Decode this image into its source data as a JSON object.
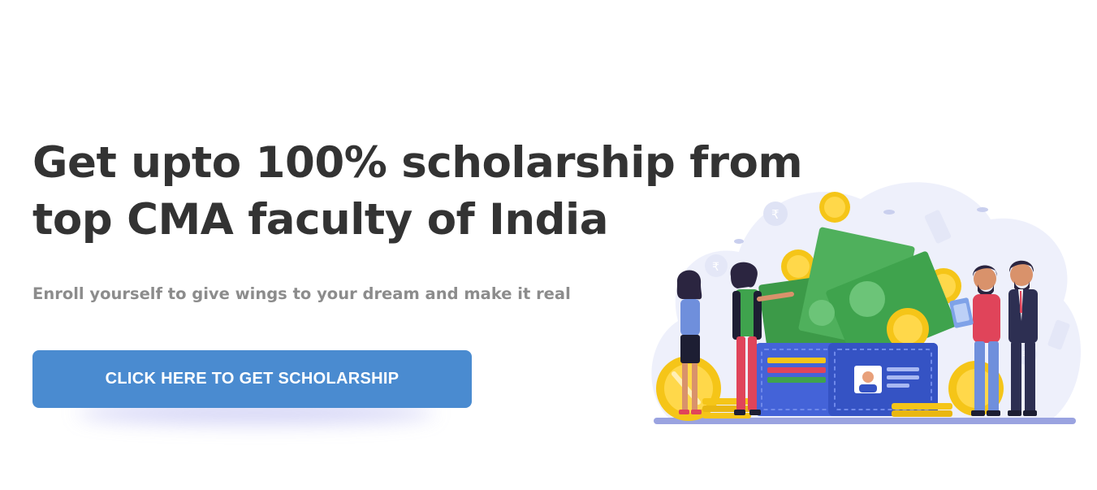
{
  "hero": {
    "headline_line1": "Get upto 100% scholarship from",
    "headline_line2": "top CMA faculty of India",
    "subtitle": "Enroll yourself to give wings to your dream and make it real",
    "cta_label": "CLICK HERE TO GET SCHOLARSHIP"
  },
  "colors": {
    "heading": "#333333",
    "subtitle": "#8c8c8c",
    "cta_background": "#4a8bd0",
    "cta_text": "#ffffff",
    "money_green": "#3fa34d",
    "coin_gold": "#f5c518",
    "wallet_blue": "#3d5fd6"
  },
  "illustration": {
    "icons": [
      "coin-icon",
      "banknote-icon",
      "wallet-icon",
      "id-card-icon",
      "rupee-icon",
      "clipboard-icon"
    ]
  }
}
